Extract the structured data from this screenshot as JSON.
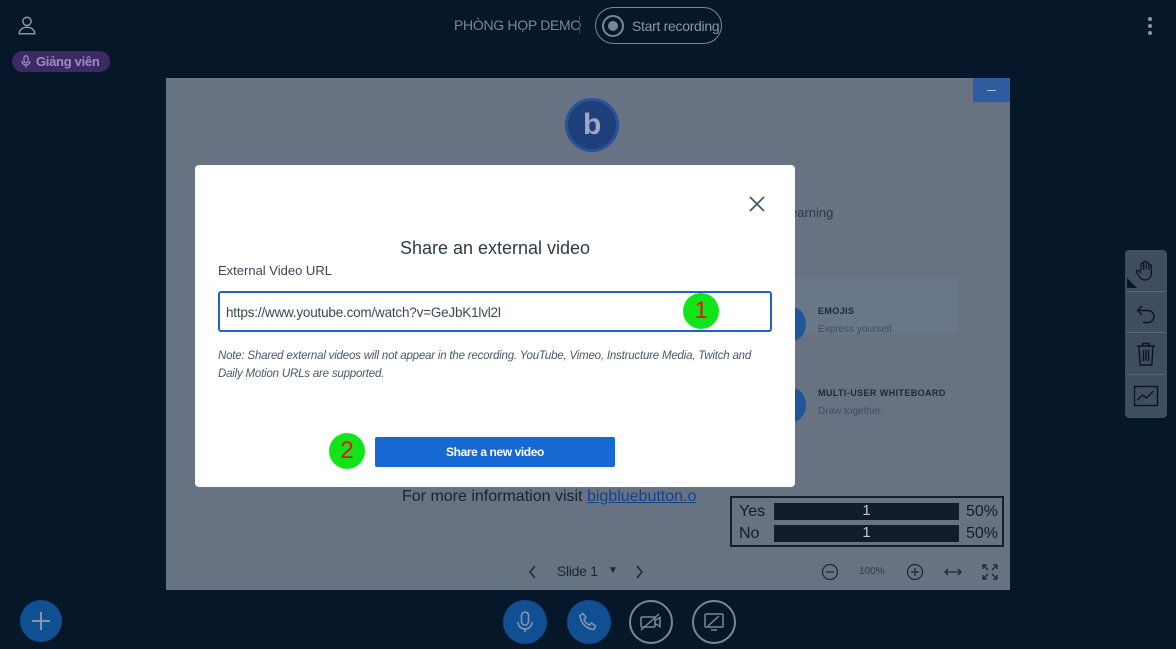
{
  "topbar": {
    "meeting_title": "PHÒNG HỌP DEMO",
    "record_label": "Start recording"
  },
  "user": {
    "role_label": "Giảng viên"
  },
  "slide": {
    "learning_text": "earning",
    "features": [
      {
        "title": "EMOJIS",
        "desc": "Express yourself."
      },
      {
        "title": "MULTI-USER WHITEBOARD",
        "desc": "Draw together."
      }
    ],
    "info_prefix": "For more information visit ",
    "info_link": "bigbluebutton.o"
  },
  "poll": {
    "rows": [
      {
        "label": "Yes",
        "count": "1",
        "percent": "50%"
      },
      {
        "label": "No",
        "count": "1",
        "percent": "50%"
      }
    ]
  },
  "presentation_toolbar": {
    "slide_label": "Slide 1",
    "zoom_label": "100%"
  },
  "modal": {
    "title": "Share an external video",
    "url_label": "External Video URL",
    "url_value": "https://www.youtube.com/watch?v=GeJbK1lvl2l",
    "note": "Note: Shared external videos will not appear in the recording. YouTube, Vimeo, Instructure Media, Twitch and Daily Motion URLs are supported.",
    "share_button": "Share a new video"
  },
  "annotations": {
    "marker_1": "1",
    "marker_2": "2"
  },
  "colors": {
    "background": "#06172a",
    "accent": "#1668d3",
    "marker_fill": "#11e51a",
    "marker_text": "#e0141a",
    "role_badge": "#3c2a63"
  }
}
